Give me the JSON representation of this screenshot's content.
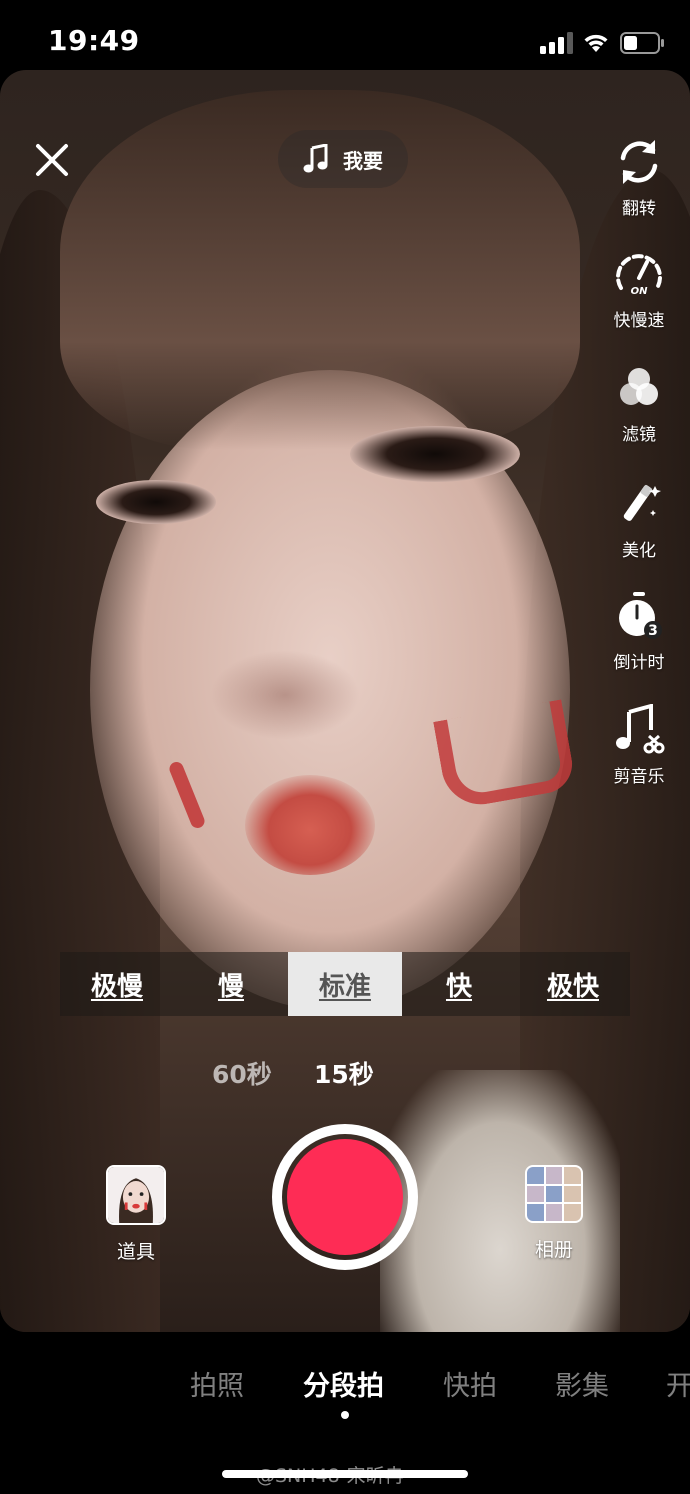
{
  "status_bar": {
    "time": "19:49"
  },
  "top": {
    "music_label": "我要"
  },
  "rail": [
    {
      "label": "翻转",
      "icon": "flip-camera-icon"
    },
    {
      "label": "快慢速",
      "icon": "speed-icon",
      "badge": "ON"
    },
    {
      "label": "滤镜",
      "icon": "filter-icon"
    },
    {
      "label": "美化",
      "icon": "beauty-wand-icon"
    },
    {
      "label": "倒计时",
      "icon": "countdown-timer-icon",
      "badge": "3"
    },
    {
      "label": "剪音乐",
      "icon": "cut-music-icon"
    }
  ],
  "speed_options": [
    "极慢",
    "慢",
    "标准",
    "快",
    "极快"
  ],
  "speed_selected": "标准",
  "durations": {
    "long": "60秒",
    "short": "15秒",
    "selected": "15秒"
  },
  "bottom": {
    "props_label": "道具",
    "album_label": "相册"
  },
  "modes": [
    "拍照",
    "分段拍",
    "快拍",
    "影集",
    "开"
  ],
  "mode_selected": "分段拍",
  "watermark": "@SNH48-宋昕冉",
  "colors": {
    "record": "#fe2c55",
    "paint": "#c23b3b"
  }
}
